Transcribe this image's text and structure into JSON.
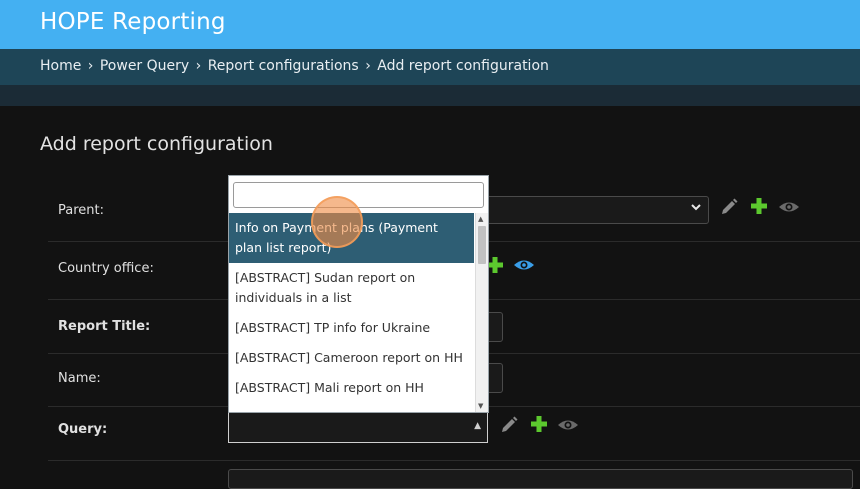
{
  "header": {
    "brand": "HOPE Reporting"
  },
  "breadcrumbs": [
    {
      "label": "Home"
    },
    {
      "label": "Power Query"
    },
    {
      "label": "Report configurations"
    },
    {
      "label": "Add report configuration"
    }
  ],
  "breadcrumb_separator": "›",
  "page": {
    "title": "Add report configuration"
  },
  "form": {
    "parent_label": "Parent:",
    "country_office_label": "Country office:",
    "report_title_label": "Report Title:",
    "name_label": "Name:",
    "query_label": "Query:"
  },
  "dropdown": {
    "search_value": "",
    "options": [
      "Info on Payment plans (Payment plan list report)",
      "[ABSTRACT] Sudan report on individuals in a list",
      "[ABSTRACT] TP info for Ukraine",
      "[ABSTRACT] Cameroon report on HH",
      "[ABSTRACT] Mali report on HH"
    ],
    "highlighted_index": 0
  },
  "icons": {
    "edit": "pencil-icon",
    "add": "plus-icon",
    "view": "eye-icon"
  },
  "colors": {
    "header": "#44b0f2",
    "breadcrumb_bar": "#1e4557",
    "add_icon": "#5cc82e",
    "view_icon_active": "#3a9ee8",
    "view_icon_inactive": "#6a6a6a",
    "highlight": "#2e5e74"
  }
}
